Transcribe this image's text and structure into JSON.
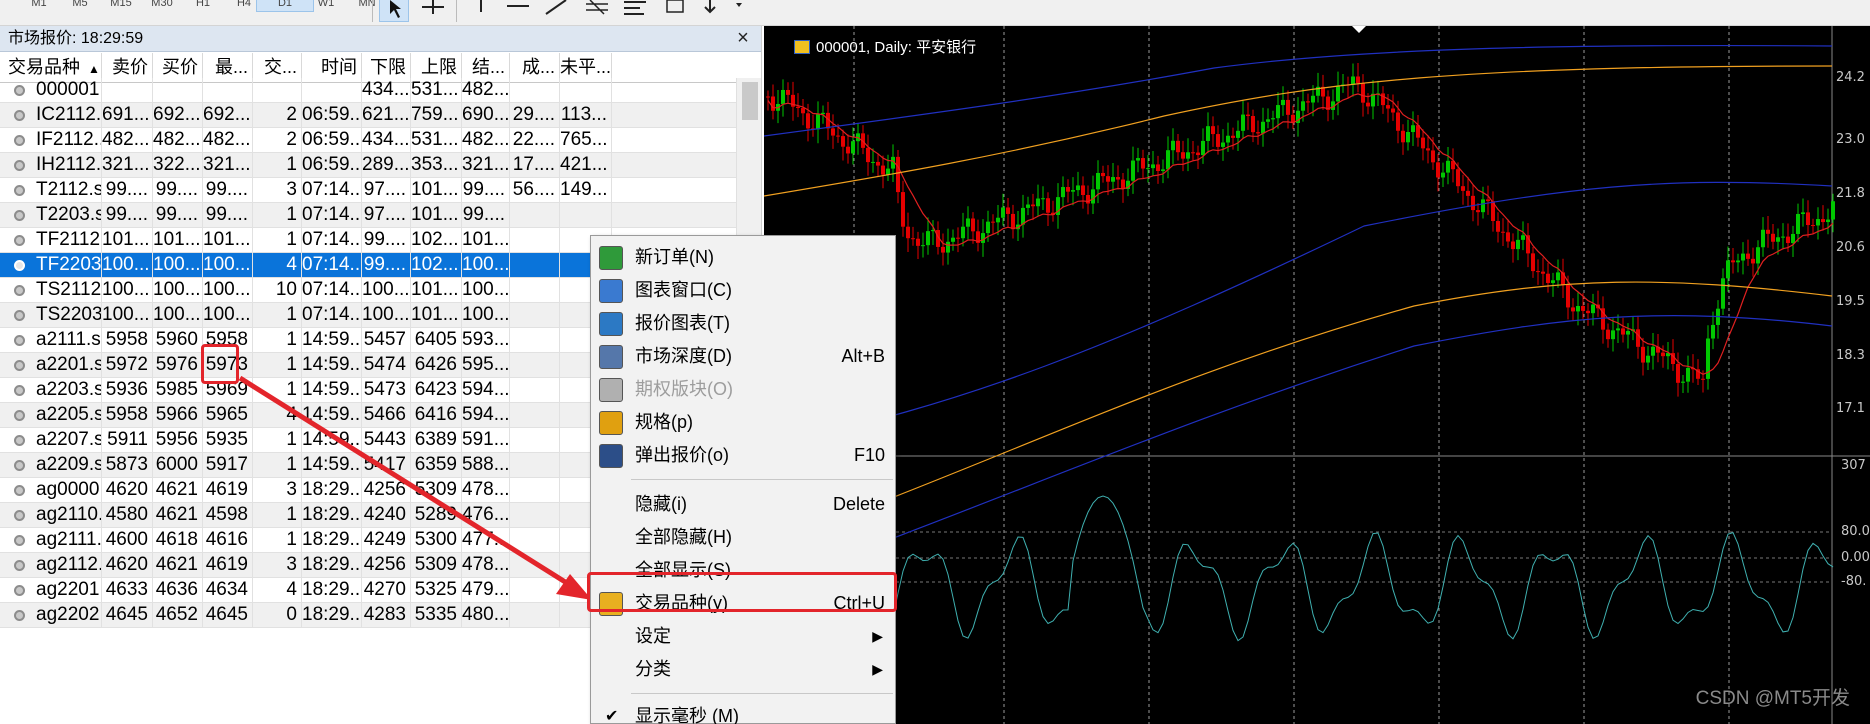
{
  "toolbar": {
    "timeframes": [
      "M1",
      "M5",
      "M15",
      "M30",
      "H1",
      "H4",
      "D1",
      "W1",
      "MN"
    ],
    "active_timeframe": "D1",
    "tools": [
      "cursor-icon",
      "crosshair-icon",
      "vertical-line-icon",
      "horizontal-line-icon",
      "trendline-icon",
      "fibonacci-icon",
      "text-icon",
      "label-icon",
      "arrows-icon"
    ]
  },
  "market_watch": {
    "title": "市场报价: 18:29:59",
    "close_label": "×",
    "sort_indicator": "▲",
    "columns": [
      "交易品种",
      "卖价",
      "买价",
      "最...",
      "交...",
      "时间",
      "下限",
      "上限",
      "结...",
      "成...",
      "未平..."
    ],
    "rows": [
      [
        "000001",
        "",
        "",
        "",
        "",
        "",
        "434...",
        "531...",
        "482...",
        "",
        ""
      ],
      [
        "IC2112....",
        "691...",
        "692...",
        "692...",
        "2",
        "06:59...",
        "621...",
        "759...",
        "690...",
        "29....",
        "113..."
      ],
      [
        "IF2112....",
        "482...",
        "482...",
        "482...",
        "2",
        "06:59...",
        "434...",
        "531...",
        "482...",
        "22....",
        "765..."
      ],
      [
        "IH2112....",
        "321...",
        "322...",
        "321...",
        "1",
        "06:59...",
        "289...",
        "353...",
        "321...",
        "17....",
        "421..."
      ],
      [
        "T2112.s...",
        "99....",
        "99....",
        "99....",
        "3",
        "07:14...",
        "97....",
        "101...",
        "99....",
        "56....",
        "149..."
      ],
      [
        "T2203.s...",
        "99....",
        "99....",
        "99....",
        "1",
        "07:14...",
        "97....",
        "101...",
        "99....",
        "",
        ""
      ],
      [
        "TF2112....",
        "101...",
        "101...",
        "101...",
        "1",
        "07:14...",
        "99....",
        "102...",
        "101...",
        "",
        ""
      ],
      [
        "TF2203....",
        "100...",
        "100...",
        "100...",
        "4",
        "07:14...",
        "99....",
        "102...",
        "100...",
        "",
        ""
      ],
      [
        "TS2112....",
        "100...",
        "100...",
        "100...",
        "10",
        "07:14...",
        "100...",
        "101...",
        "100...",
        "",
        ""
      ],
      [
        "TS2203....",
        "100...",
        "100...",
        "100...",
        "1",
        "07:14...",
        "100...",
        "101...",
        "100...",
        "",
        ""
      ],
      [
        "a2111.s...",
        "5958",
        "5960",
        "5958",
        "1",
        "14:59...",
        "5457",
        "6405",
        "593...",
        "",
        ""
      ],
      [
        "a2201.s...",
        "5972",
        "5976",
        "5973",
        "1",
        "14:59...",
        "5474",
        "6426",
        "595...",
        "",
        ""
      ],
      [
        "a2203.s...",
        "5936",
        "5985",
        "5969",
        "1",
        "14:59...",
        "5473",
        "6423",
        "594...",
        "",
        ""
      ],
      [
        "a2205.s...",
        "5958",
        "5966",
        "5965",
        "4",
        "14:59...",
        "5466",
        "6416",
        "594...",
        "",
        ""
      ],
      [
        "a2207.s...",
        "5911",
        "5956",
        "5935",
        "1",
        "14:59...",
        "5443",
        "6389",
        "591...",
        "",
        ""
      ],
      [
        "a2209.s...",
        "5873",
        "6000",
        "5917",
        "1",
        "14:59...",
        "5417",
        "6359",
        "588...",
        "",
        ""
      ],
      [
        "ag0000....",
        "4620",
        "4621",
        "4619",
        "3",
        "18:29...",
        "4256",
        "5309",
        "478...",
        "",
        ""
      ],
      [
        "ag2110....",
        "4580",
        "4621",
        "4598",
        "1",
        "18:29...",
        "4240",
        "5289",
        "476...",
        "",
        ""
      ],
      [
        "ag2111....",
        "4600",
        "4618",
        "4616",
        "1",
        "18:29...",
        "4249",
        "5300",
        "477...",
        "",
        ""
      ],
      [
        "ag2112....",
        "4620",
        "4621",
        "4619",
        "3",
        "18:29...",
        "4256",
        "5309",
        "478...",
        "",
        ""
      ],
      [
        "ag2201....",
        "4633",
        "4636",
        "4634",
        "4",
        "18:29...",
        "4270",
        "5325",
        "479...",
        "",
        ""
      ],
      [
        "ag2202....",
        "4645",
        "4652",
        "4645",
        "0",
        "18:29...",
        "4283",
        "5335",
        "480...",
        "",
        ""
      ]
    ],
    "selected_row_index": 7
  },
  "chart": {
    "title": "000001, Daily:  平安银行",
    "price_labels": [
      "24.2",
      "23.0",
      "21.8",
      "20.6",
      "19.5",
      "18.3",
      "17.1"
    ],
    "indicator_labels": [
      "307",
      "80.0",
      "0.00",
      "-80."
    ],
    "watermark": "CSDN @MT5开发",
    "colors": {
      "background": "#000000",
      "bull": "#00c800",
      "bear": "#e60000",
      "ma_fast": "#e02020",
      "ma_slow": "#f0a020",
      "envelope": "#2030c0",
      "indicator": "#3fb0b0"
    }
  },
  "context_menu": {
    "items": [
      {
        "label": "新订单(N)",
        "shortcut": "",
        "icon": "new-order-icon",
        "disabled": false
      },
      {
        "label": "图表窗口(C)",
        "shortcut": "",
        "icon": "chart-window-icon",
        "disabled": false
      },
      {
        "label": "报价图表(T)",
        "shortcut": "",
        "icon": "tick-chart-icon",
        "disabled": false
      },
      {
        "label": "市场深度(D)",
        "shortcut": "Alt+B",
        "icon": "market-depth-icon",
        "disabled": false
      },
      {
        "label": "期权版块(O)",
        "shortcut": "",
        "icon": "options-board-icon",
        "disabled": true
      },
      {
        "label": "规格(p)",
        "shortcut": "",
        "icon": "specification-icon",
        "disabled": false
      },
      {
        "label": "弹出报价(o)",
        "shortcut": "F10",
        "icon": "popup-prices-icon",
        "disabled": false
      },
      {
        "label": "隐藏(i)",
        "shortcut": "Delete",
        "icon": "",
        "disabled": false
      },
      {
        "label": "全部隐藏(H)",
        "shortcut": "",
        "icon": "",
        "disabled": false
      },
      {
        "label": "全部显示(S)",
        "shortcut": "",
        "icon": "",
        "disabled": false
      },
      {
        "label": "交易品种(y)",
        "shortcut": "Ctrl+U",
        "icon": "symbols-icon",
        "disabled": false
      },
      {
        "label": "设定",
        "shortcut": "",
        "icon": "",
        "disabled": false,
        "submenu": true
      },
      {
        "label": "分类",
        "shortcut": "",
        "icon": "",
        "disabled": false,
        "submenu": true
      },
      {
        "label": "显示毫秒 (M)",
        "shortcut": "",
        "icon": "",
        "disabled": false,
        "checked": true
      }
    ],
    "highlighted_item": "交易品种(y)",
    "submenu_arrow": "▶",
    "check_mark": "✔"
  }
}
